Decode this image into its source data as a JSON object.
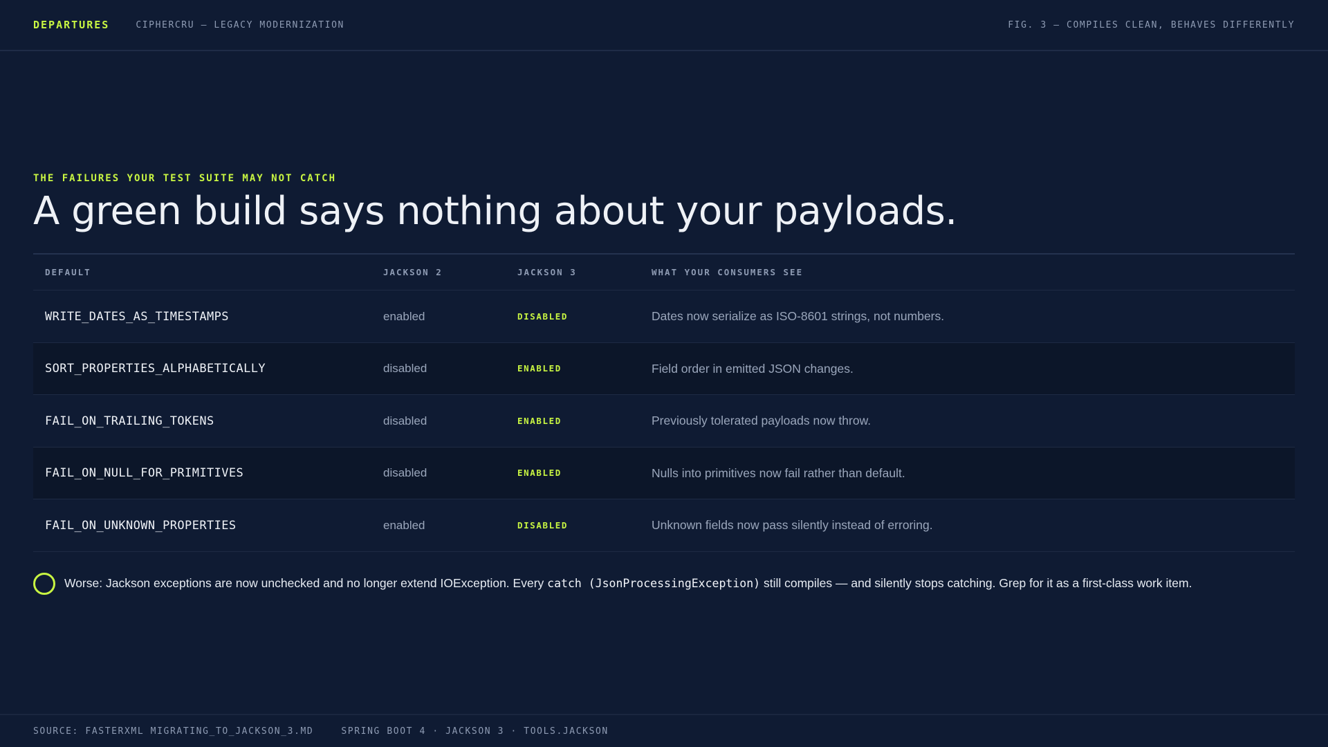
{
  "header": {
    "brand": "DEPARTURES",
    "subtitle": "CIPHERCRU — LEGACY MODERNIZATION",
    "figure": "FIG. 3 — COMPILES CLEAN, BEHAVES DIFFERENTLY"
  },
  "section": {
    "kicker": "THE FAILURES YOUR TEST SUITE MAY NOT CATCH",
    "headline": "A green build says nothing about your payloads."
  },
  "table": {
    "columns": [
      "DEFAULT",
      "JACKSON 2",
      "JACKSON 3",
      "WHAT YOUR CONSUMERS SEE"
    ],
    "rows": [
      {
        "key": "WRITE_DATES_AS_TIMESTAMPS",
        "jackson2": "enabled",
        "jackson3": "DISABLED",
        "effect": "Dates now serialize as ISO-8601 strings, not numbers."
      },
      {
        "key": "SORT_PROPERTIES_ALPHABETICALLY",
        "jackson2": "disabled",
        "jackson3": "ENABLED",
        "effect": "Field order in emitted JSON changes."
      },
      {
        "key": "FAIL_ON_TRAILING_TOKENS",
        "jackson2": "disabled",
        "jackson3": "ENABLED",
        "effect": "Previously tolerated payloads now throw."
      },
      {
        "key": "FAIL_ON_NULL_FOR_PRIMITIVES",
        "jackson2": "disabled",
        "jackson3": "ENABLED",
        "effect": "Nulls into primitives now fail rather than default."
      },
      {
        "key": "FAIL_ON_UNKNOWN_PROPERTIES",
        "jackson2": "enabled",
        "jackson3": "DISABLED",
        "effect": "Unknown fields now pass silently instead of erroring."
      }
    ]
  },
  "note": {
    "before": "Worse: Jackson exceptions are now unchecked and no longer extend IOException. Every ",
    "code": "catch (JsonProcessingException)",
    "after": " still compiles — and silently stops catching. Grep for it as a first-class work item."
  },
  "footer": {
    "source": "SOURCE: FASTERXML MIGRATING_TO_JACKSON_3.MD",
    "stack": "SPRING BOOT 4 · JACKSON 3 · TOOLS.JACKSON"
  },
  "colors": {
    "background": "#0f1b33",
    "accent": "#c8f542",
    "muted": "#8e9bb3"
  }
}
